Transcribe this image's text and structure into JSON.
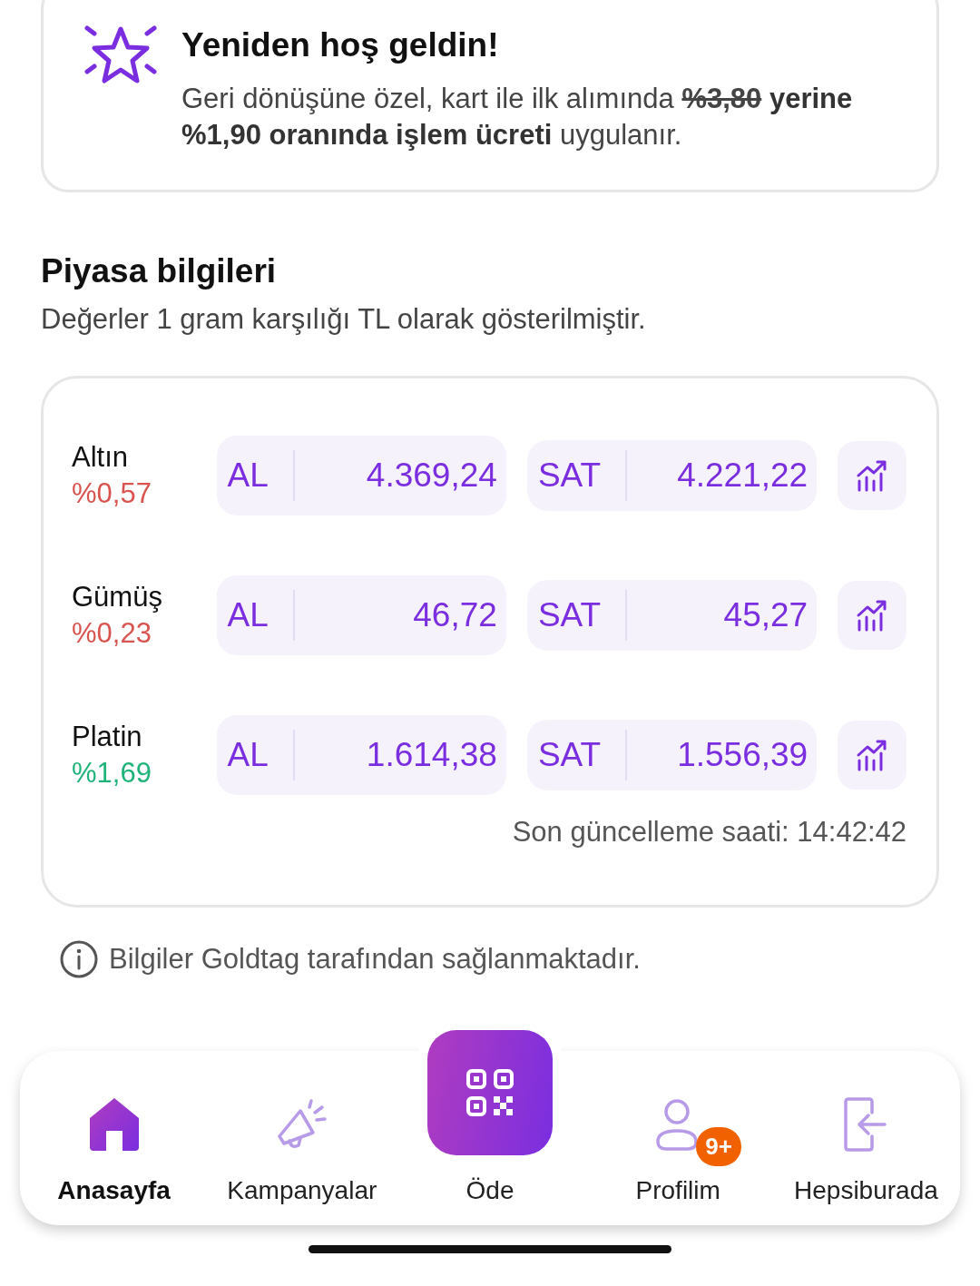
{
  "welcome": {
    "title": "Yeniden hoş geldin!",
    "message_parts": [
      {
        "text": "Geri dönüşüne özel, kart ile ilk alımında ",
        "kind": "plain"
      },
      {
        "text": "%3,80",
        "kind": "old-rate"
      },
      {
        "text": " yerine %1,90 oranında işlem ücreti",
        "kind": "highlight"
      },
      {
        "text": " uygulanır.",
        "kind": "plain"
      }
    ]
  },
  "market": {
    "title": "Piyasa bilgileri",
    "subtitle": "Değerler 1 gram karşılığı TL olarak gösterilmiştir.",
    "rows": [
      {
        "name": "Altın",
        "change": "%0,57",
        "rising": false,
        "buy_label": "AL",
        "buy": "4.369,24",
        "sell_label": "SAT",
        "sell": "4.221,22"
      },
      {
        "name": "Gümüş",
        "change": "%0,23",
        "rising": false,
        "buy_label": "AL",
        "buy": "46,72",
        "sell_label": "SAT",
        "sell": "45,27"
      },
      {
        "name": "Platin",
        "change": "%1,69",
        "rising": true,
        "buy_label": "AL",
        "buy": "1.614,38",
        "sell_label": "SAT",
        "sell": "1.556,39"
      }
    ],
    "updated": "Son güncelleme saati: 14:42:42"
  },
  "info": "Bilgiler Goldtag tarafından sağlanmaktadır.",
  "nav": [
    {
      "kind": "home",
      "label": "Anasayfa",
      "selected": true
    },
    {
      "kind": "campaigns",
      "label": "Kampanyalar",
      "selected": false
    },
    {
      "kind": "pay",
      "label": "Öde",
      "selected": false
    },
    {
      "kind": "profile",
      "label": "Profilim",
      "selected": false,
      "badge": "9+"
    },
    {
      "kind": "exit",
      "label": "Hepsiburada",
      "selected": false
    }
  ]
}
